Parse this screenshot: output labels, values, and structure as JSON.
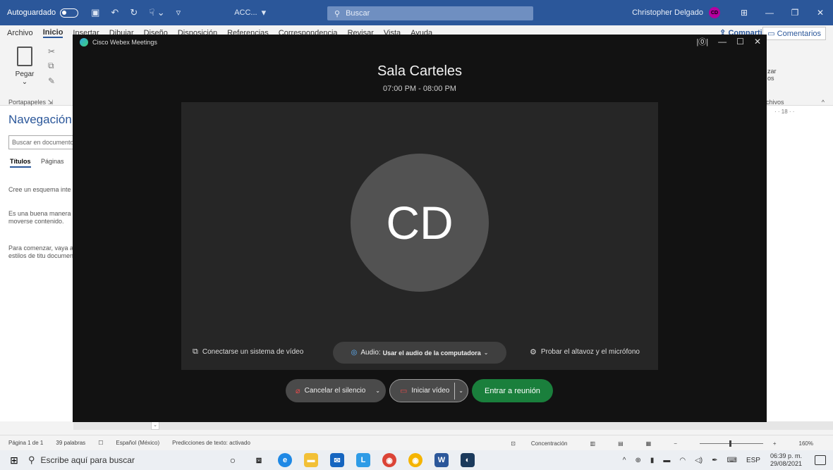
{
  "word": {
    "autosave_label": "Autoguardado",
    "doc_name": "ACC...",
    "search_placeholder": "Buscar",
    "user_name": "Christopher Delgado",
    "user_initials": "CD",
    "tabs": [
      "Archivo",
      "Inicio",
      "Insertar",
      "Dibujar",
      "Diseño",
      "Disposición",
      "Referencias",
      "Correspondencia",
      "Revisar",
      "Vista",
      "Ayuda"
    ],
    "share_label": "Compartir",
    "comments_label": "Comentarios",
    "paste_label": "Pegar",
    "clipboard_group": "Portapapeles",
    "ribbon_right_a": "zar",
    "ribbon_right_a2": "os",
    "ribbon_right_b": "chivos",
    "ruler_text": "· · 18 · ·"
  },
  "nav": {
    "title": "Navegación",
    "search_placeholder": "Buscar en documento",
    "tab_titles": "Títulos",
    "tab_pages": "Páginas",
    "text1": "Cree un esquema inte documento.",
    "text2": "Es una buena manera encuentra o moverse contenido.",
    "text3": "Para comenzar, vaya a aplique estilos de titu documento."
  },
  "status": {
    "page": "Página 1 de 1",
    "words": "39 palabras",
    "language": "Español (México)",
    "predictions": "Predicciones de texto: activado",
    "focus": "Concentración",
    "zoom": "160%"
  },
  "taskbar": {
    "search_placeholder": "Escribe aquí para buscar",
    "lang": "ESP",
    "time": "06:39 p. m.",
    "date": "29/08/2021"
  },
  "webex": {
    "app_title": "Cisco Webex Meetings",
    "meeting_title": "Sala Carteles",
    "meeting_time": "07:00 PM - 08:00 PM",
    "avatar_initials": "CD",
    "connect_video_system": "Conectarse un sistema de vídeo",
    "audio_label": "Audio:",
    "audio_value": "Usar el audio de la computadora",
    "test_audio": "Probar el altavoz y el micrófono",
    "mute_label": "Cancelar el silencio",
    "video_label": "Iniciar vídeo",
    "join_label": "Entrar a reunión"
  },
  "colors": {
    "word_blue": "#2b579a",
    "webex_bg": "#121212",
    "join_green": "#1a7f3c",
    "mute_red": "#e34b4b"
  }
}
